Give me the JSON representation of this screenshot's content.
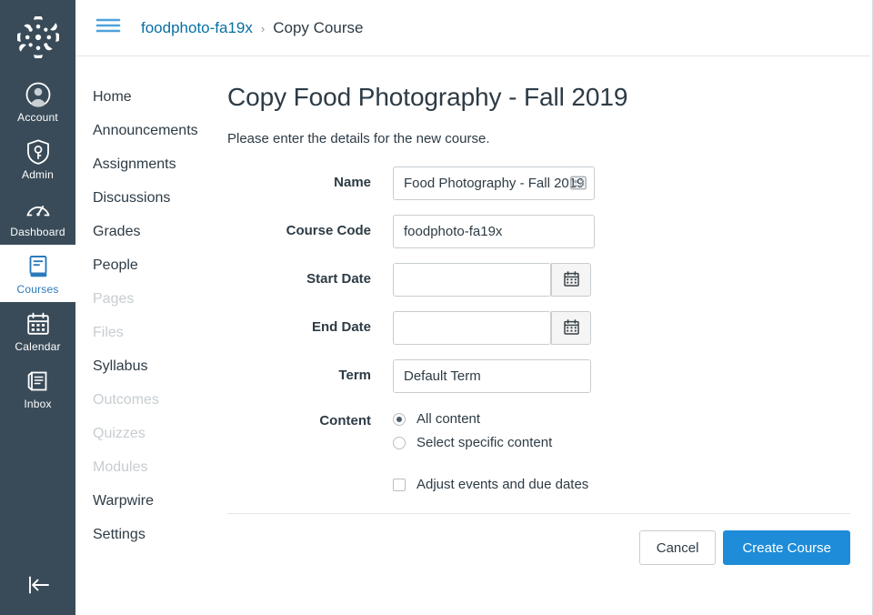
{
  "global_nav": {
    "logo_name": "canvas-logo",
    "items": [
      {
        "label": "Account",
        "icon": "account-icon",
        "active": false
      },
      {
        "label": "Admin",
        "icon": "admin-shield-icon",
        "active": false
      },
      {
        "label": "Dashboard",
        "icon": "dashboard-icon",
        "active": false
      },
      {
        "label": "Courses",
        "icon": "courses-book-icon",
        "active": true
      },
      {
        "label": "Calendar",
        "icon": "calendar-icon",
        "active": false
      },
      {
        "label": "Inbox",
        "icon": "inbox-icon",
        "active": false
      }
    ],
    "collapse_label": "Minimize Global Navigation",
    "collapse_icon": "collapse-left-arrow-icon"
  },
  "header": {
    "menu_icon": "hamburger-menu-icon",
    "breadcrumb": {
      "course_link": "foodphoto-fa19x",
      "separator": "›",
      "current": "Copy Course"
    }
  },
  "course_nav": {
    "items": [
      {
        "label": "Home",
        "dim": false
      },
      {
        "label": "Announcements",
        "dim": false
      },
      {
        "label": "Assignments",
        "dim": false
      },
      {
        "label": "Discussions",
        "dim": false
      },
      {
        "label": "Grades",
        "dim": false
      },
      {
        "label": "People",
        "dim": false
      },
      {
        "label": "Pages",
        "dim": true
      },
      {
        "label": "Files",
        "dim": true
      },
      {
        "label": "Syllabus",
        "dim": false
      },
      {
        "label": "Outcomes",
        "dim": true
      },
      {
        "label": "Quizzes",
        "dim": true
      },
      {
        "label": "Modules",
        "dim": true
      },
      {
        "label": "Warpwire",
        "dim": false
      },
      {
        "label": "Settings",
        "dim": false
      }
    ]
  },
  "content": {
    "title": "Copy Food Photography - Fall 2019",
    "subtitle": "Please enter the details for the new course.",
    "fields": {
      "name": {
        "label": "Name",
        "value": "Food Photography - Fall 2019",
        "placeholder": "",
        "icon": "address-card-autofill-icon"
      },
      "course_code": {
        "label": "Course Code",
        "value": "foodphoto-fa19x",
        "placeholder": ""
      },
      "start_date": {
        "label": "Start Date",
        "value": "",
        "placeholder": "",
        "button_icon": "calendar-icon"
      },
      "end_date": {
        "label": "End Date",
        "value": "",
        "placeholder": "",
        "button_icon": "calendar-icon"
      },
      "term": {
        "label": "Term",
        "value": "Default Term",
        "placeholder": ""
      },
      "content": {
        "label": "Content",
        "options": [
          {
            "label": "All content",
            "selected": true
          },
          {
            "label": "Select specific content",
            "selected": false
          }
        ],
        "adjust_dates": {
          "label": "Adjust events and due dates",
          "checked": false
        }
      }
    }
  },
  "footer": {
    "cancel_label": "Cancel",
    "create_label": "Create Course"
  },
  "colors": {
    "nav_background": "#394B58",
    "primary_blue": "#1E8CD8",
    "link_blue": "#0770A3",
    "active_blue": "#2B7ABC",
    "text_dark": "#2D3B45",
    "text_dim": "#C7CDD1",
    "border": "#C7CDD1"
  }
}
